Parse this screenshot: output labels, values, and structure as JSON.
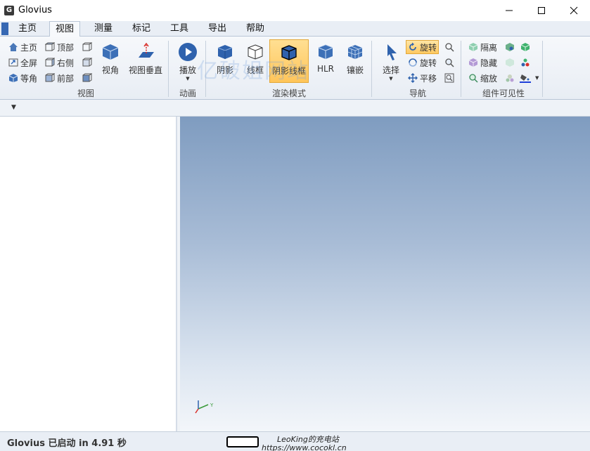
{
  "window": {
    "title": "Glovius",
    "app_icon_letter": "G"
  },
  "menu": {
    "items": [
      "主页",
      "视图",
      "测量",
      "标记",
      "工具",
      "导出",
      "帮助"
    ],
    "active": "视图"
  },
  "ribbon": {
    "view_group": {
      "label": "视图",
      "home": "主页",
      "top": "顶部",
      "fit_all": "全屏",
      "right": "右侧",
      "isometric": "等角",
      "front": "前部",
      "view_angle": "视角",
      "view_normal": "视图垂直"
    },
    "animation_group": {
      "label": "动画",
      "play": "播放"
    },
    "render_group": {
      "label": "渲染模式",
      "shaded": "阴影",
      "wireframe": "线框",
      "shaded_wireframe": "阴影线框",
      "hlr": "HLR",
      "embed": "镶嵌"
    },
    "nav_group": {
      "label": "导航",
      "select": "选择",
      "rotate_active": "旋转",
      "rotate": "旋转",
      "pan": "平移"
    },
    "visibility_group": {
      "label": "组件可见性",
      "isolate": "隔离",
      "hide": "隐藏",
      "zoom": "缩放"
    }
  },
  "watermark": "亿破姐网站",
  "viewport": {
    "axis_y_label": "Y"
  },
  "status": {
    "text": "Glovius  已启动 in 4.91 秒"
  },
  "credit": {
    "name": "LeoKing的充电站",
    "url": "https://www.cocokl.cn"
  },
  "colors": {
    "accent": "#3768b3",
    "active_button": "#ffc55a",
    "viewport_top": "#7f9cc0",
    "viewport_bottom": "#f3f6fa"
  }
}
